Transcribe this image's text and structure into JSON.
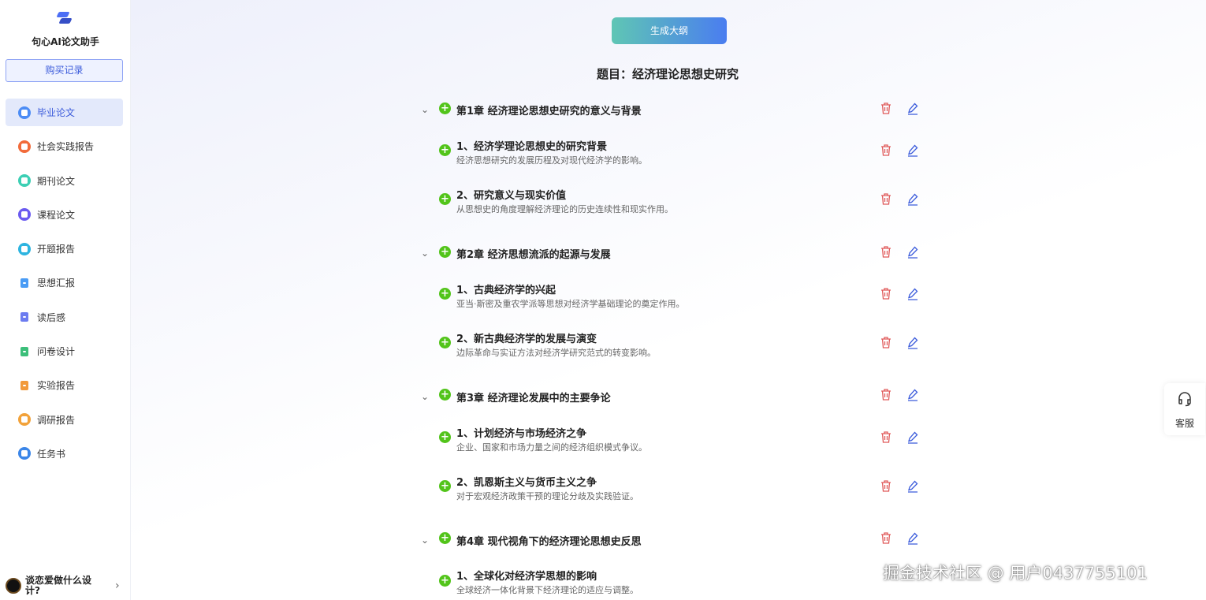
{
  "app": {
    "title": "句心AI论文助手",
    "purchase_label": "购买记录"
  },
  "sidebar": {
    "items": [
      {
        "label": "毕业论文",
        "icon": "thesis-icon",
        "color": "#4c8cf5",
        "active": true
      },
      {
        "label": "社会实践报告",
        "icon": "report-icon",
        "color": "#f26b3a"
      },
      {
        "label": "期刊论文",
        "icon": "journal-icon",
        "color": "#3ccfb4"
      },
      {
        "label": "课程论文",
        "icon": "course-icon",
        "color": "#6a5af0"
      },
      {
        "label": "开题报告",
        "icon": "proposal-icon",
        "color": "#2db4e0"
      },
      {
        "label": "思想汇报",
        "icon": "thought-icon",
        "color": "#4a9cf5"
      },
      {
        "label": "读后感",
        "icon": "reading-icon",
        "color": "#6c7cf0"
      },
      {
        "label": "问卷设计",
        "icon": "survey-icon",
        "color": "#3cbf7a"
      },
      {
        "label": "实验报告",
        "icon": "experiment-icon",
        "color": "#f29a3a"
      },
      {
        "label": "调研报告",
        "icon": "research-icon",
        "color": "#f2a23a"
      },
      {
        "label": "任务书",
        "icon": "task-icon",
        "color": "#3b86e8"
      }
    ]
  },
  "user": {
    "name": "谈恋爱做什么设计?"
  },
  "main": {
    "generate_label": "生成大纲",
    "topic": "题目：经济理论思想史研究",
    "chapters": [
      {
        "title": "第1章  经济理论思想史研究的意义与背景",
        "sections": [
          {
            "title": "1、经济学理论思想史的研究背景",
            "desc": "经济思想研究的发展历程及对现代经济学的影响。"
          },
          {
            "title": "2、研究意义与现实价值",
            "desc": "从思想史的角度理解经济理论的历史连续性和现实作用。"
          }
        ]
      },
      {
        "title": "第2章  经济思想流派的起源与发展",
        "sections": [
          {
            "title": "1、古典经济学的兴起",
            "desc": "亚当·斯密及重农学派等思想对经济学基础理论的奠定作用。"
          },
          {
            "title": "2、新古典经济学的发展与演变",
            "desc": "边际革命与实证方法对经济学研究范式的转变影响。"
          }
        ]
      },
      {
        "title": "第3章  经济理论发展中的主要争论",
        "sections": [
          {
            "title": "1、计划经济与市场经济之争",
            "desc": "企业、国家和市场力量之间的经济组织模式争议。"
          },
          {
            "title": "2、凯恩斯主义与货币主义之争",
            "desc": "对于宏观经济政策干预的理论分歧及实践验证。"
          }
        ]
      },
      {
        "title": "第4章  现代视角下的经济理论思想史反思",
        "sections": [
          {
            "title": "1、全球化对经济学思想的影响",
            "desc": "全球经济一体化背景下经济理论的适应与调整。"
          }
        ]
      }
    ]
  },
  "service": {
    "label": "客服"
  },
  "watermark": "掘金技术社区 @ 用户0437755101",
  "colors": {
    "accent": "#3b5bdb",
    "add": "#52c41a",
    "delete": "#e05a5a",
    "edit": "#3b5bdb"
  }
}
